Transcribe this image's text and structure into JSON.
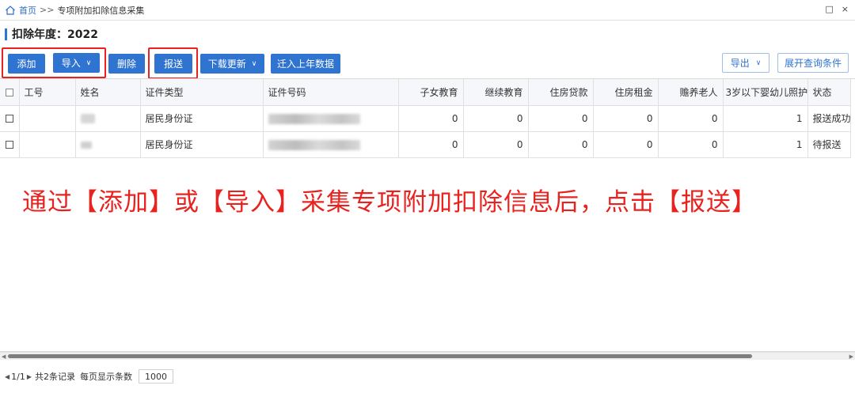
{
  "breadcrumb": {
    "home": "首页",
    "separator": ">>",
    "current": "专项附加扣除信息采集"
  },
  "window_controls": {
    "restore": "□",
    "close": "×"
  },
  "year_title": "扣除年度：2022",
  "toolbar": {
    "add": "添加",
    "import": "导入",
    "delete": "删除",
    "report": "报送",
    "download_update": "下载更新",
    "migrate_last_year": "迁入上年数据",
    "export": "导出",
    "expand_query": "展开查询条件"
  },
  "table": {
    "headers": [
      "工号",
      "姓名",
      "证件类型",
      "证件号码",
      "子女教育",
      "继续教育",
      "住房贷款",
      "住房租金",
      "赡养老人",
      "3岁以下婴幼儿照护",
      "状态"
    ],
    "rows": [
      {
        "emp_no": "",
        "id_type": "居民身份证",
        "child_edu": "0",
        "cont_edu": "0",
        "housing_loan": "0",
        "housing_rent": "0",
        "elderly": "0",
        "infant_care": "1",
        "status": "报送成功"
      },
      {
        "emp_no": "",
        "id_type": "居民身份证",
        "child_edu": "0",
        "cont_edu": "0",
        "housing_loan": "0",
        "housing_rent": "0",
        "elderly": "0",
        "infant_care": "1",
        "status": "待报送"
      }
    ]
  },
  "annotation": "通过【添加】或【导入】采集专项附加扣除信息后，点击【报送】",
  "pager": {
    "page": "1/1",
    "total": "共2条记录",
    "per_page_label": "每页显示条数",
    "page_size": "1000"
  },
  "colors": {
    "primary": "#2f74d0",
    "highlight": "#e8221e"
  }
}
